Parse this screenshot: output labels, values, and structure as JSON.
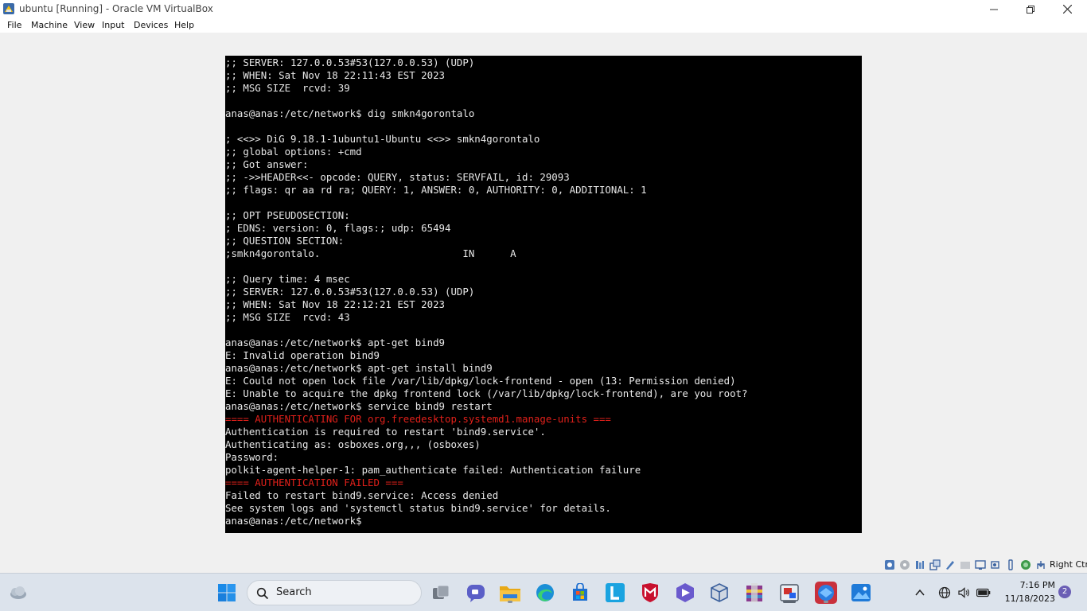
{
  "window": {
    "title": "ubuntu [Running] - Oracle VM VirtualBox",
    "icons": [
      "virtualbox-app-icon",
      "minimize-icon",
      "restore-icon",
      "close-icon"
    ]
  },
  "menu": {
    "items": [
      "File",
      "Machine",
      "View",
      "Input",
      "Devices",
      "Help"
    ]
  },
  "terminal": {
    "prompt": "anas@anas:/etc/network$",
    "lines": [
      {
        "text": ";; SERVER: 127.0.0.53#53(127.0.0.53) (UDP)",
        "style": "normal"
      },
      {
        "text": ";; WHEN: Sat Nov 18 22:11:43 EST 2023",
        "style": "normal"
      },
      {
        "text": ";; MSG SIZE  rcvd: 39",
        "style": "normal"
      },
      {
        "text": "",
        "style": "normal"
      },
      {
        "text": "anas@anas:/etc/network$ dig smkn4gorontalo",
        "style": "normal"
      },
      {
        "text": "",
        "style": "normal"
      },
      {
        "text": "; <<>> DiG 9.18.1-1ubuntu1-Ubuntu <<>> smkn4gorontalo",
        "style": "normal"
      },
      {
        "text": ";; global options: +cmd",
        "style": "normal"
      },
      {
        "text": ";; Got answer:",
        "style": "normal"
      },
      {
        "text": ";; ->>HEADER<<- opcode: QUERY, status: SERVFAIL, id: 29093",
        "style": "normal"
      },
      {
        "text": ";; flags: qr aa rd ra; QUERY: 1, ANSWER: 0, AUTHORITY: 0, ADDITIONAL: 1",
        "style": "normal"
      },
      {
        "text": "",
        "style": "normal"
      },
      {
        "text": ";; OPT PSEUDOSECTION:",
        "style": "normal"
      },
      {
        "text": "; EDNS: version: 0, flags:; udp: 65494",
        "style": "normal"
      },
      {
        "text": ";; QUESTION SECTION:",
        "style": "normal"
      },
      {
        "text": ";smkn4gorontalo.                        IN      A",
        "style": "normal"
      },
      {
        "text": "",
        "style": "normal"
      },
      {
        "text": ";; Query time: 4 msec",
        "style": "normal"
      },
      {
        "text": ";; SERVER: 127.0.0.53#53(127.0.0.53) (UDP)",
        "style": "normal"
      },
      {
        "text": ";; WHEN: Sat Nov 18 22:12:21 EST 2023",
        "style": "normal"
      },
      {
        "text": ";; MSG SIZE  rcvd: 43",
        "style": "normal"
      },
      {
        "text": "",
        "style": "normal"
      },
      {
        "text": "anas@anas:/etc/network$ apt-get bind9",
        "style": "normal"
      },
      {
        "text": "E: Invalid operation bind9",
        "style": "normal"
      },
      {
        "text": "anas@anas:/etc/network$ apt-get install bind9",
        "style": "normal"
      },
      {
        "text": "E: Could not open lock file /var/lib/dpkg/lock-frontend - open (13: Permission denied)",
        "style": "normal"
      },
      {
        "text": "E: Unable to acquire the dpkg frontend lock (/var/lib/dpkg/lock-frontend), are you root?",
        "style": "normal"
      },
      {
        "text": "anas@anas:/etc/network$ service bind9 restart",
        "style": "normal"
      },
      {
        "text": "==== AUTHENTICATING FOR org.freedesktop.systemd1.manage-units ===",
        "style": "red"
      },
      {
        "text": "Authentication is required to restart 'bind9.service'.",
        "style": "normal"
      },
      {
        "text": "Authenticating as: osboxes.org,,, (osboxes)",
        "style": "normal"
      },
      {
        "text": "Password:",
        "style": "normal"
      },
      {
        "text": "polkit-agent-helper-1: pam_authenticate failed: Authentication failure",
        "style": "normal"
      },
      {
        "text": "==== AUTHENTICATION FAILED ===",
        "style": "red"
      },
      {
        "text": "Failed to restart bind9.service: Access denied",
        "style": "normal"
      },
      {
        "text": "See system logs and 'systemctl status bind9.service' for details.",
        "style": "normal"
      },
      {
        "text": "anas@anas:/etc/network$",
        "style": "normal"
      }
    ]
  },
  "statusbar": {
    "icons": [
      "optical-drive-icon",
      "audio-icon",
      "network-icon",
      "usb-icon",
      "shared-folders-icon",
      "display-icon",
      "video-capture-icon",
      "recording-icon",
      "cpu-icon",
      "mouse-integration-icon",
      "keyboard-icon"
    ],
    "host_key": "Right Ctrl"
  },
  "taskbar": {
    "search_label": "Search",
    "time": "7:16 PM",
    "date": "11/18/2023",
    "notification_count": "2",
    "apps": [
      "widgets-weather-icon",
      "start-icon",
      "task-view-icon",
      "teams-chat-icon",
      "file-explorer-icon",
      "edge-icon",
      "store-icon",
      "l-app-icon",
      "mcafee-icon",
      "vpn-shield-icon",
      "virtualbox-icon",
      "winrar-icon",
      "snipping-tool-icon",
      "browser-app-icon",
      "photos-icon"
    ],
    "tray": [
      "chevron-up-icon",
      "globe-icon",
      "volume-icon",
      "battery-icon"
    ]
  },
  "colors": {
    "terminal_bg": "#000000",
    "terminal_fg": "#e8e8e8",
    "terminal_red": "#e0201a",
    "taskbar_bg": "#dce3ec"
  }
}
